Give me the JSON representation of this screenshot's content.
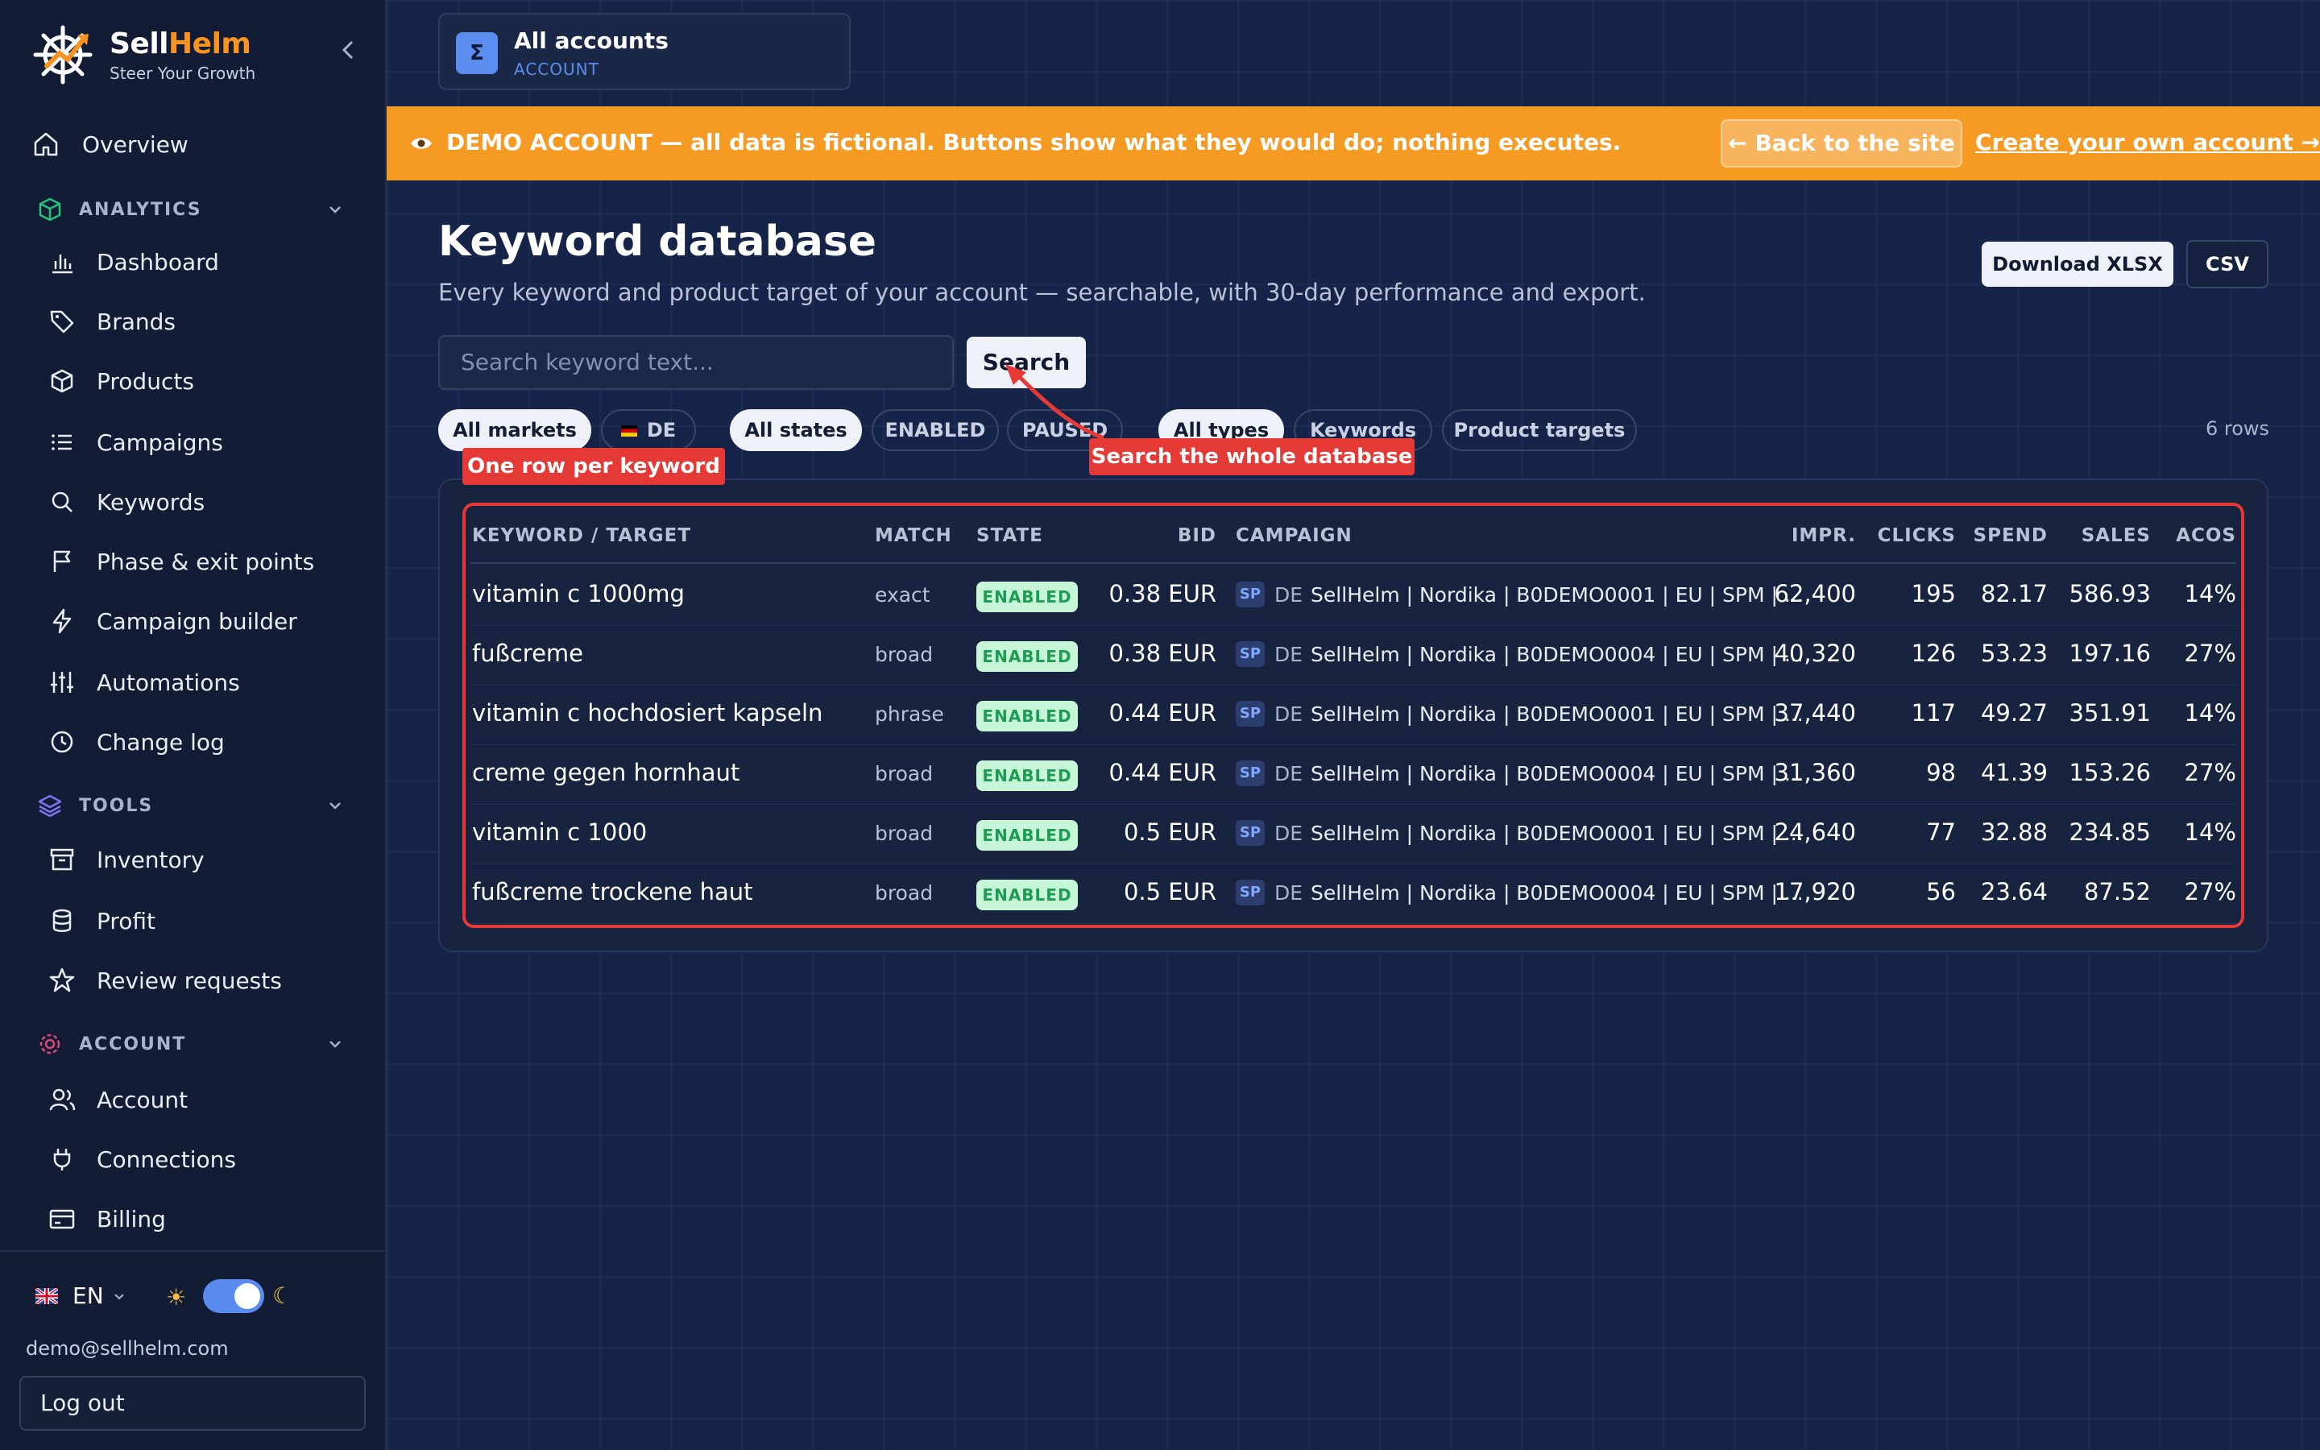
{
  "brand": {
    "name_main": "Sell",
    "name_accent": "Helm",
    "tagline": "Steer Your Growth"
  },
  "nav": {
    "overview": "Overview",
    "sections": {
      "analytics": "ANALYTICS",
      "tools": "TOOLS",
      "account": "ACCOUNT"
    },
    "analytics_items": [
      "Dashboard",
      "Brands",
      "Products",
      "Campaigns",
      "Keywords",
      "Phase & exit points",
      "Campaign builder",
      "Automations",
      "Change log"
    ],
    "tools_items": [
      "Inventory",
      "Profit",
      "Review requests"
    ],
    "account_items": [
      "Account",
      "Connections",
      "Billing"
    ]
  },
  "footer": {
    "language": "EN",
    "email": "demo@sellhelm.com",
    "logout_label": "Log out"
  },
  "account_switcher": {
    "icon": "Σ",
    "title": "All accounts",
    "subtitle": "ACCOUNT"
  },
  "banner": {
    "text": "DEMO ACCOUNT — all data is fictional. Buttons show what they would do; nothing executes.",
    "back_label": "← Back to the site",
    "create_label": "Create your own account →"
  },
  "page": {
    "title": "Keyword database",
    "subtitle": "Every keyword and product target of your account — searchable, with 30-day performance and export.",
    "download_xlsx": "Download XLSX",
    "csv": "CSV"
  },
  "search": {
    "placeholder": "Search keyword text...",
    "button": "Search"
  },
  "filters": {
    "markets": [
      "All markets",
      "DE"
    ],
    "states": [
      "All states",
      "ENABLED",
      "PAUSED"
    ],
    "types": [
      "All types",
      "Keywords",
      "Product targets"
    ],
    "rows_count": "6 rows"
  },
  "table": {
    "headers": [
      "KEYWORD / TARGET",
      "MATCH",
      "STATE",
      "BID",
      "CAMPAIGN",
      "IMPR.",
      "CLICKS",
      "SPEND",
      "SALES",
      "ACOS"
    ],
    "rows": [
      {
        "keyword": "vitamin c 1000mg",
        "match": "exact",
        "state": "ENABLED",
        "bid": "0.38 EUR",
        "type": "SP",
        "market": "DE",
        "campaign": "SellHelm | Nordika | B0DEMO0001 | EU | SPM | ...",
        "impr": "62,400",
        "clicks": "195",
        "spend": "82.17",
        "sales": "586.93",
        "acos": "14%"
      },
      {
        "keyword": "fußcreme",
        "match": "broad",
        "state": "ENABLED",
        "bid": "0.38 EUR",
        "type": "SP",
        "market": "DE",
        "campaign": "SellHelm | Nordika | B0DEMO0004 | EU | SPM | ...",
        "impr": "40,320",
        "clicks": "126",
        "spend": "53.23",
        "sales": "197.16",
        "acos": "27%"
      },
      {
        "keyword": "vitamin c hochdosiert kapseln",
        "match": "phrase",
        "state": "ENABLED",
        "bid": "0.44 EUR",
        "type": "SP",
        "market": "DE",
        "campaign": "SellHelm | Nordika | B0DEMO0001 | EU | SPM | ...",
        "impr": "37,440",
        "clicks": "117",
        "spend": "49.27",
        "sales": "351.91",
        "acos": "14%"
      },
      {
        "keyword": "creme gegen hornhaut",
        "match": "broad",
        "state": "ENABLED",
        "bid": "0.44 EUR",
        "type": "SP",
        "market": "DE",
        "campaign": "SellHelm | Nordika | B0DEMO0004 | EU | SPM | ...",
        "impr": "31,360",
        "clicks": "98",
        "spend": "41.39",
        "sales": "153.26",
        "acos": "27%"
      },
      {
        "keyword": "vitamin c 1000",
        "match": "broad",
        "state": "ENABLED",
        "bid": "0.5 EUR",
        "type": "SP",
        "market": "DE",
        "campaign": "SellHelm | Nordika | B0DEMO0001 | EU | SPM | ...",
        "impr": "24,640",
        "clicks": "77",
        "spend": "32.88",
        "sales": "234.85",
        "acos": "14%"
      },
      {
        "keyword": "fußcreme trockene haut",
        "match": "broad",
        "state": "ENABLED",
        "bid": "0.5 EUR",
        "type": "SP",
        "market": "DE",
        "campaign": "SellHelm | Nordika | B0DEMO0004 | EU | SPM | ...",
        "impr": "17,920",
        "clicks": "56",
        "spend": "23.64",
        "sales": "87.52",
        "acos": "27%"
      }
    ]
  },
  "annotations": {
    "row_callout": "One row per keyword",
    "search_callout": "Search the whole database"
  },
  "colors": {
    "accent": "#f7931e",
    "banner": "#f59a23",
    "annotation": "#e53935",
    "badge_bg": "#c6f5d8",
    "badge_text": "#1e9b55",
    "toggle": "#5a8cf0"
  },
  "icons": {
    "overview": "home-icon",
    "dashboard": "bar-chart-icon",
    "brands": "tag-icon",
    "products": "box-icon",
    "campaigns": "list-icon",
    "keywords": "search-icon",
    "phase": "flag-icon",
    "builder": "lightning-icon",
    "automations": "sliders-icon",
    "changelog": "clock-icon",
    "inventory": "archive-icon",
    "profit": "database-icon",
    "reviews": "star-icon",
    "account": "users-icon",
    "connections": "plug-icon",
    "billing": "credit-card-icon"
  }
}
